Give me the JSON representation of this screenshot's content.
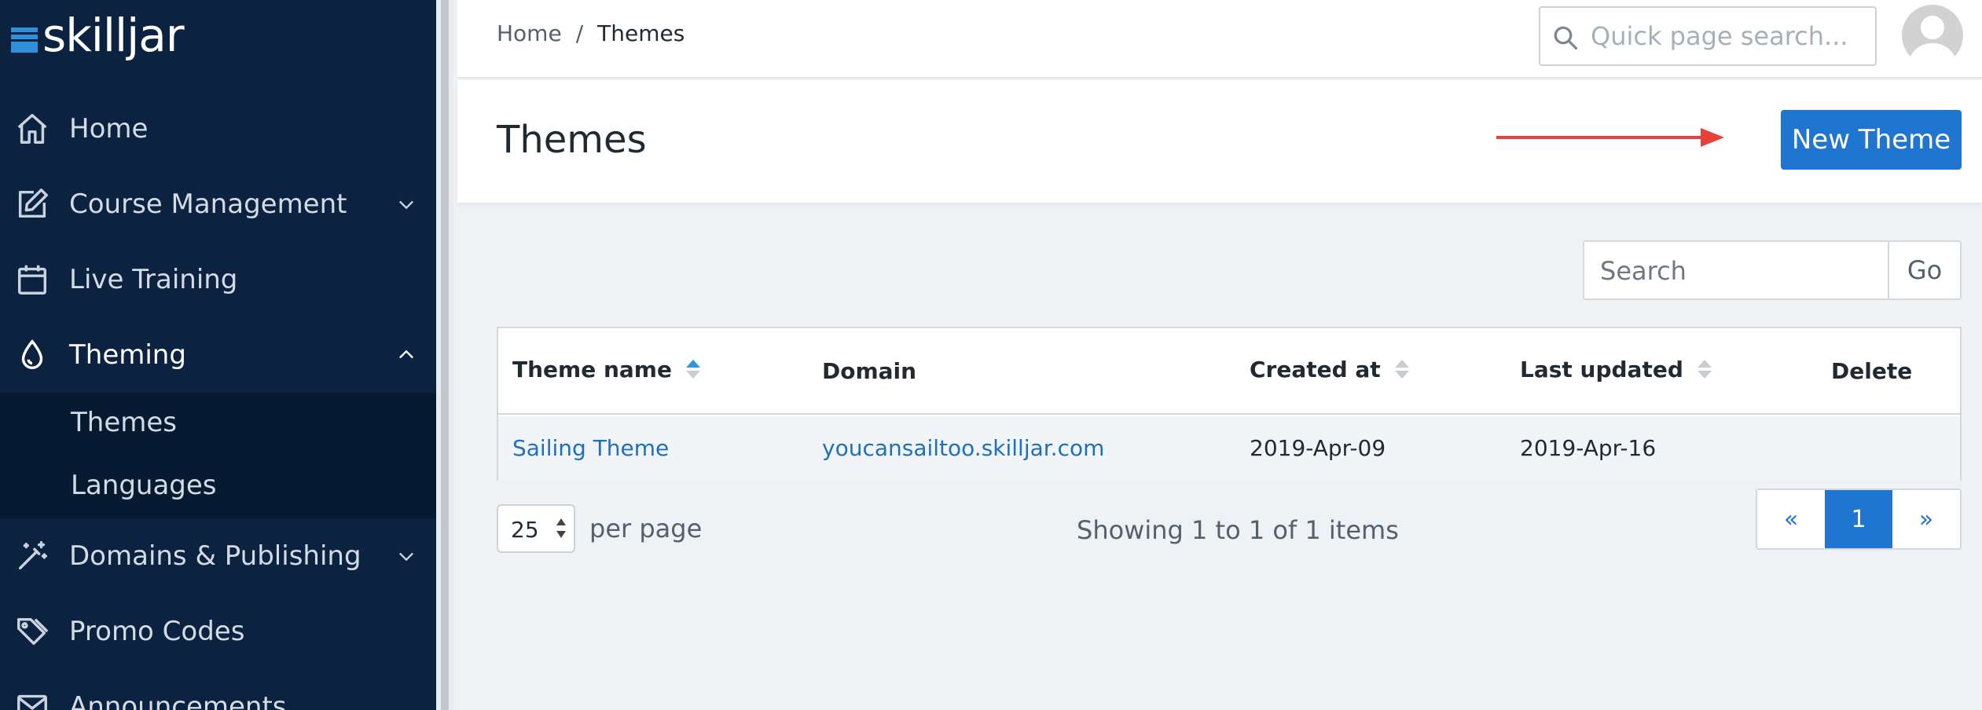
{
  "brand": {
    "name": "skilljar"
  },
  "sidebar": {
    "items": [
      {
        "label": "Home",
        "icon": "home-icon"
      },
      {
        "label": "Course Management",
        "icon": "edit-icon",
        "expandable": true,
        "expanded": false
      },
      {
        "label": "Live Training",
        "icon": "calendar-icon"
      },
      {
        "label": "Theming",
        "icon": "droplet-icon",
        "expandable": true,
        "expanded": true
      },
      {
        "label": "Domains & Publishing",
        "icon": "magic-wand-icon",
        "expandable": true,
        "expanded": false
      },
      {
        "label": "Promo Codes",
        "icon": "tag-icon"
      },
      {
        "label": "Announcements",
        "icon": "mail-icon"
      }
    ],
    "theming_subitems": [
      {
        "label": "Themes",
        "selected": true
      },
      {
        "label": "Languages"
      }
    ]
  },
  "header": {
    "breadcrumb": {
      "home": "Home",
      "separator": "/",
      "current": "Themes"
    },
    "quick_search_placeholder": "Quick page search..."
  },
  "page": {
    "title": "Themes",
    "new_button_label": "New Theme"
  },
  "table_search": {
    "placeholder": "Search",
    "go_label": "Go"
  },
  "table": {
    "columns": [
      "Theme name",
      "Domain",
      "Created at",
      "Last updated",
      "Delete"
    ],
    "rows": [
      {
        "name": "Sailing Theme",
        "domain": "youcansailtoo.skilljar.com",
        "created": "2019-Apr-09",
        "updated": "2019-Apr-16"
      }
    ]
  },
  "pagination": {
    "per_page_value": "25",
    "per_page_label": "per page",
    "summary": "Showing 1 to 1 of 1 items",
    "prev": "«",
    "current": "1",
    "next": "»"
  },
  "colors": {
    "sidebar_bg": "#0b2240",
    "primary": "#1f75cf",
    "link": "#1f6fbf",
    "annotation_arrow": "#e8413b"
  }
}
